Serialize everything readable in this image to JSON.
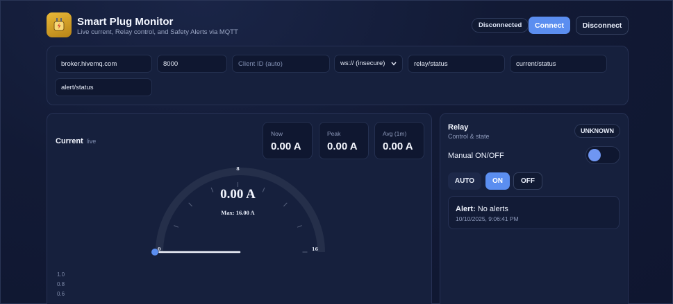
{
  "app": {
    "title": "Smart Plug Monitor",
    "subtitle": "Live current, Relay control, and Safety Alerts via MQTT",
    "icon": "plug-bolt-icon"
  },
  "connection": {
    "status": "Disconnected",
    "connect_label": "Connect",
    "disconnect_label": "Disconnect"
  },
  "config": {
    "broker": "broker.hivemq.com",
    "port": "8000",
    "client_id_placeholder": "Client ID (auto)",
    "protocol": "ws:// (insecure)",
    "relay_topic": "relay/status",
    "current_topic": "current/status",
    "alert_topic": "alert/status"
  },
  "current": {
    "title": "Current",
    "live_label": "live",
    "stats": [
      {
        "label": "Now",
        "value": "0.00 A"
      },
      {
        "label": "Peak",
        "value": "0.00 A"
      },
      {
        "label": "Avg (1m)",
        "value": "0.00 A"
      }
    ],
    "gauge": {
      "value_text": "0.00 A",
      "max_text": "Max: 16.00 A",
      "min_label": "0",
      "mid_label": "8",
      "max_label": "16",
      "value": 0,
      "max": 16
    },
    "chart_y_ticks": [
      "1.0",
      "0.8",
      "0.6"
    ]
  },
  "relay": {
    "title": "Relay",
    "subtitle": "Control & state",
    "state": "UNKNOWN",
    "manual_label": "Manual ON/OFF",
    "modes": [
      "AUTO",
      "ON",
      "OFF"
    ],
    "active_mode": "ON"
  },
  "alert": {
    "label": "Alert:",
    "text": "No alerts",
    "timestamp": "10/10/2025, 9:06:41 PM"
  },
  "colors": {
    "accent": "#5b8ef0",
    "background": "#121a35",
    "panel": "#16203d",
    "logo": "#e0a92f"
  }
}
